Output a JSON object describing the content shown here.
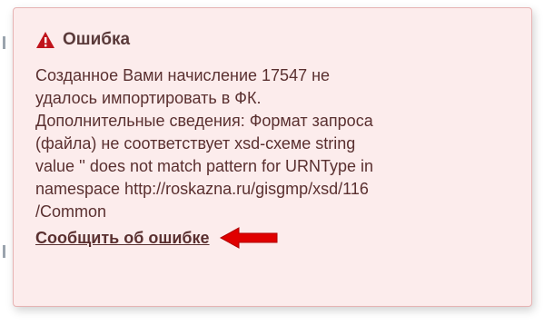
{
  "error_popup": {
    "title": "Ошибка",
    "icon": "warning-triangle-icon",
    "message_lines": [
      "Созданное Вами начисление 17547 не",
      "удалось импортировать в ФК.",
      "Дополнительные сведения: Формат запроса",
      "(файла) не соответствует xsd-схеме string",
      "value '' does not match pattern for URNType in",
      "namespace http://roskazna.ru/gisgmp/xsd/116",
      "/Common"
    ],
    "report_link_label": "Сообщить об ошибке",
    "annotation_arrow": "red-arrow-left-icon"
  },
  "colors": {
    "popup_background": "#fcecec",
    "popup_border": "#e6b3b3",
    "icon_red": "#c0141c",
    "text": "#5a3030",
    "arrow_red": "#e00000"
  }
}
